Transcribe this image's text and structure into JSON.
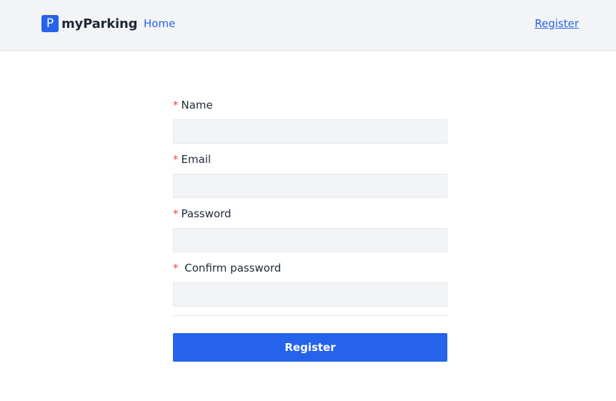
{
  "header": {
    "brand_icon": "P",
    "brand_name": "myParking",
    "nav_home": "Home",
    "nav_register": "Register"
  },
  "form": {
    "required_mark": "*",
    "fields": [
      {
        "label": "Name",
        "value": ""
      },
      {
        "label": "Email",
        "value": ""
      },
      {
        "label": "Password",
        "value": ""
      },
      {
        "label": "Confirm password",
        "value": ""
      }
    ],
    "submit_label": "Register"
  },
  "colors": {
    "accent": "#2563eb",
    "required": "#ef4444"
  }
}
